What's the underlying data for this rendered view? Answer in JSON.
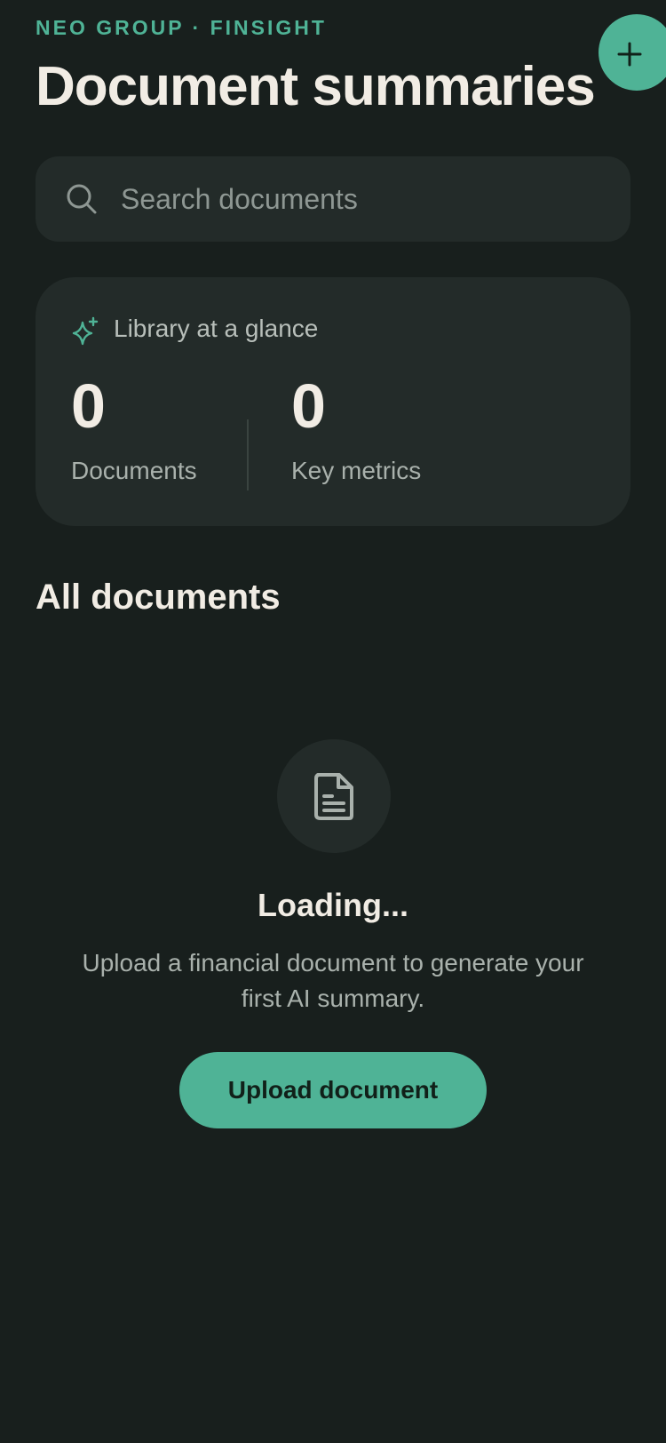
{
  "header": {
    "brand": "NEO GROUP · FINSIGHT",
    "title": "Document summaries",
    "add_icon": "plus-icon"
  },
  "search": {
    "placeholder": "Search documents",
    "value": "",
    "icon": "search-icon"
  },
  "glance": {
    "icon": "sparkle-icon",
    "label": "Library at a glance",
    "stats": [
      {
        "value": "0",
        "label": "Documents"
      },
      {
        "value": "0",
        "label": "Key metrics"
      }
    ]
  },
  "documents": {
    "section_title": "All documents",
    "empty_state": {
      "icon": "document-icon",
      "title": "Loading...",
      "description": "Upload a financial document to generate your first AI summary.",
      "button_label": "Upload document"
    }
  },
  "colors": {
    "background": "#181f1d",
    "card": "#232b29",
    "accent": "#4fb396",
    "text": "#f1ece4",
    "muted": "#a9b1ac"
  }
}
